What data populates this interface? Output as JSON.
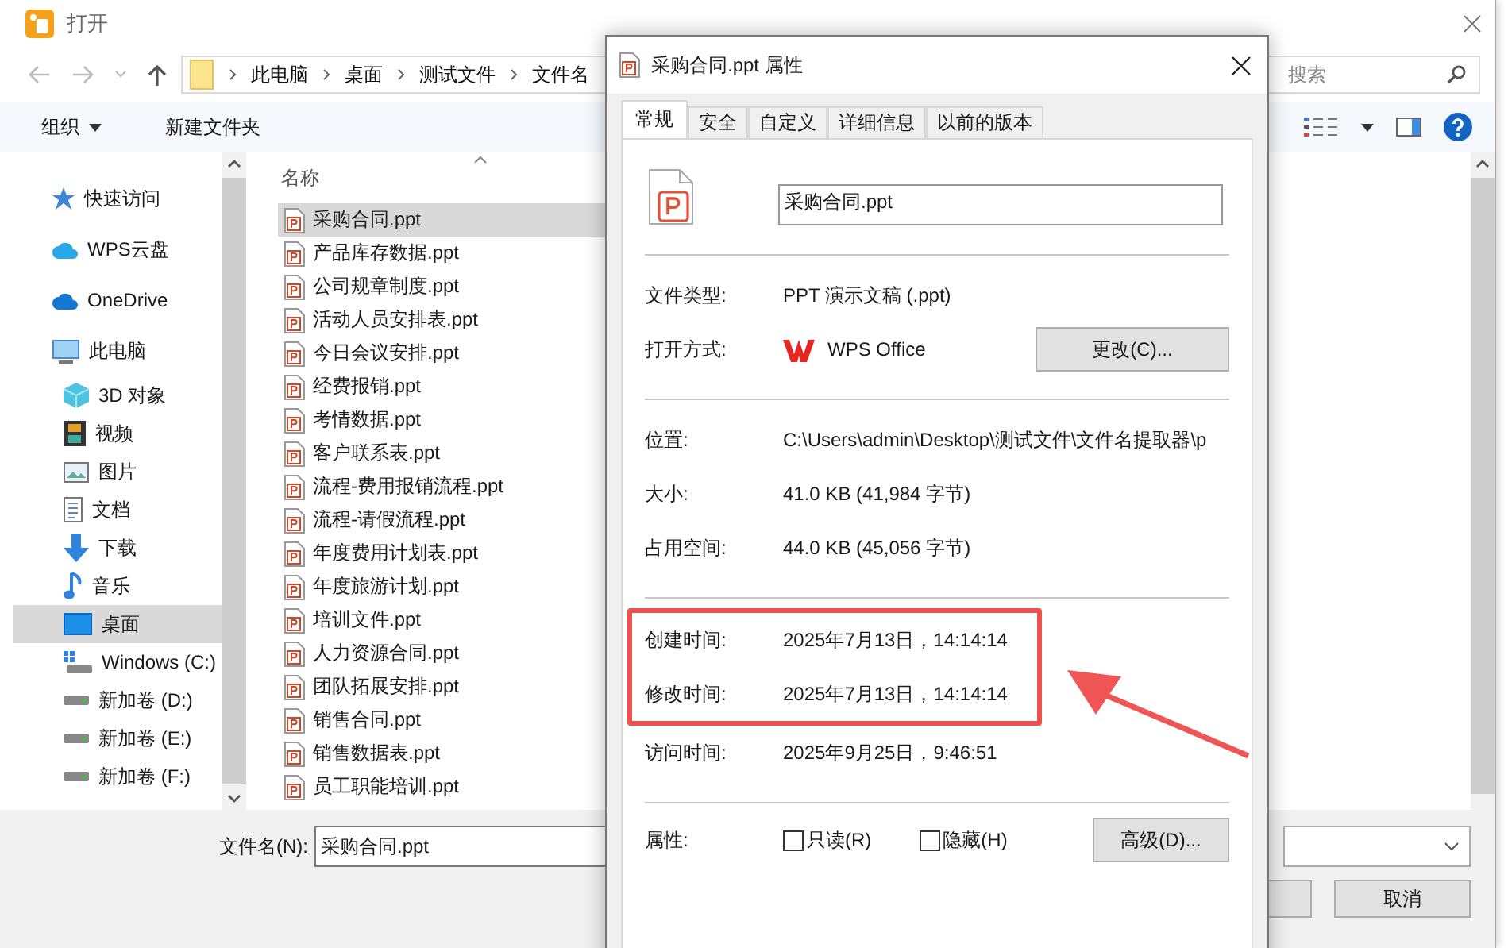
{
  "window": {
    "title": "打开"
  },
  "nav": {
    "path": [
      "此电脑",
      "桌面",
      "测试文件",
      "文件名"
    ],
    "search": {
      "placeholder": "搜索"
    }
  },
  "toolbar": {
    "organize": "组织",
    "new_folder": "新建文件夹"
  },
  "sidebar": {
    "items": [
      {
        "label": "快速访问",
        "kind": "star",
        "selected": false
      },
      {
        "label": "WPS云盘",
        "kind": "wps-cloud",
        "selected": false
      },
      {
        "label": "OneDrive",
        "kind": "cloud",
        "selected": false
      },
      {
        "label": "此电脑",
        "kind": "computer",
        "selected": false,
        "children": [
          {
            "label": "3D 对象",
            "kind": "cube",
            "selected": false
          },
          {
            "label": "视频",
            "kind": "film",
            "selected": false
          },
          {
            "label": "图片",
            "kind": "picture",
            "selected": false
          },
          {
            "label": "文档",
            "kind": "document",
            "selected": false
          },
          {
            "label": "下载",
            "kind": "download",
            "selected": false
          },
          {
            "label": "音乐",
            "kind": "music",
            "selected": false
          },
          {
            "label": "桌面",
            "kind": "desktop",
            "selected": true
          },
          {
            "label": "Windows (C:)",
            "kind": "system-drive",
            "selected": false
          },
          {
            "label": "新加卷 (D:)",
            "kind": "drive",
            "selected": false
          },
          {
            "label": "新加卷 (E:)",
            "kind": "drive",
            "selected": false
          },
          {
            "label": "新加卷 (F:)",
            "kind": "drive",
            "selected": false
          }
        ]
      }
    ]
  },
  "file_list": {
    "column": "名称",
    "files": [
      {
        "name": "采购合同.ppt",
        "selected": true
      },
      {
        "name": "产品库存数据.ppt",
        "selected": false
      },
      {
        "name": "公司规章制度.ppt",
        "selected": false
      },
      {
        "name": "活动人员安排表.ppt",
        "selected": false
      },
      {
        "name": "今日会议安排.ppt",
        "selected": false
      },
      {
        "name": "经费报销.ppt",
        "selected": false
      },
      {
        "name": "考情数据.ppt",
        "selected": false
      },
      {
        "name": "客户联系表.ppt",
        "selected": false
      },
      {
        "name": "流程-费用报销流程.ppt",
        "selected": false
      },
      {
        "name": "流程-请假流程.ppt",
        "selected": false
      },
      {
        "name": "年度费用计划表.ppt",
        "selected": false
      },
      {
        "name": "年度旅游计划.ppt",
        "selected": false
      },
      {
        "name": "培训文件.ppt",
        "selected": false
      },
      {
        "name": "人力资源合同.ppt",
        "selected": false
      },
      {
        "name": "团队拓展安排.ppt",
        "selected": false
      },
      {
        "name": "销售合同.ppt",
        "selected": false
      },
      {
        "name": "销售数据表.ppt",
        "selected": false
      },
      {
        "name": "员工职能培训.ppt",
        "selected": false
      }
    ]
  },
  "bottom": {
    "filename_label": "文件名(N):",
    "filename": "采购合同.ppt",
    "cancel": "取消"
  },
  "properties": {
    "title": "采购合同.ppt 属性",
    "tabs": [
      {
        "label": "常规",
        "selected": true
      },
      {
        "label": "安全",
        "selected": false
      },
      {
        "label": "自定义",
        "selected": false
      },
      {
        "label": "详细信息",
        "selected": false
      },
      {
        "label": "以前的版本",
        "selected": false
      }
    ],
    "name": "采购合同.ppt",
    "sections": [
      {
        "rows": [
          {
            "kind": "text",
            "label": "文件类型:",
            "value": "PPT 演示文稿 (.ppt)"
          },
          {
            "kind": "app",
            "label": "打开方式:",
            "value": "WPS Office",
            "button": "更改(C)..."
          }
        ]
      },
      {
        "rows": [
          {
            "kind": "text",
            "label": "位置:",
            "value": "C:\\Users\\admin\\Desktop\\测试文件\\文件名提取器\\p"
          },
          {
            "kind": "text",
            "label": "大小:",
            "value": "41.0 KB (41,984 字节)"
          },
          {
            "kind": "text",
            "label": "占用空间:",
            "value": "44.0 KB (45,056 字节)"
          }
        ]
      },
      {
        "highlight": [
          {
            "kind": "text",
            "label": "创建时间:",
            "value": "2025年7月13日，14:14:14"
          },
          {
            "kind": "text",
            "label": "修改时间:",
            "value": "2025年7月13日，14:14:14"
          }
        ],
        "rows": [
          {
            "kind": "text",
            "label": "访问时间:",
            "value": "2025年9月25日，9:46:51"
          }
        ]
      }
    ],
    "attributes": {
      "label": "属性:",
      "options": [
        {
          "label": "只读(R)",
          "checked": false
        },
        {
          "label": "隐藏(H)",
          "checked": false
        }
      ],
      "button": "高级(D)..."
    }
  }
}
